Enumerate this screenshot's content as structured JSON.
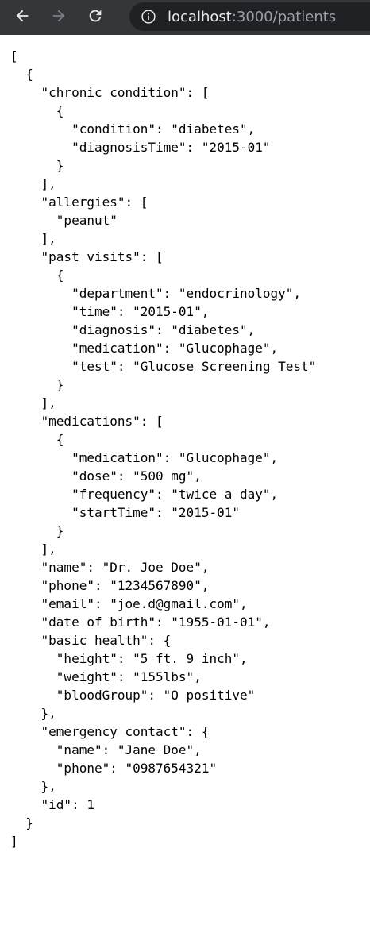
{
  "browser": {
    "back_icon": "arrow-left-icon",
    "forward_icon": "arrow-right-icon",
    "reload_icon": "reload-icon",
    "site_info_icon": "info-icon",
    "url_host": "localhost",
    "url_rest": ":3000/patients"
  },
  "json_lines": [
    "[",
    "  {",
    "    \"chronic condition\": [",
    "      {",
    "        \"condition\": \"diabetes\",",
    "        \"diagnosisTime\": \"2015-01\"",
    "      }",
    "    ],",
    "    \"allergies\": [",
    "      \"peanut\"",
    "    ],",
    "    \"past visits\": [",
    "      {",
    "        \"department\": \"endocrinology\",",
    "        \"time\": \"2015-01\",",
    "        \"diagnosis\": \"diabetes\",",
    "        \"medication\": \"Glucophage\",",
    "        \"test\": \"Glucose Screening Test\"",
    "      }",
    "    ],",
    "    \"medications\": [",
    "      {",
    "        \"medication\": \"Glucophage\",",
    "        \"dose\": \"500 mg\",",
    "        \"frequency\": \"twice a day\",",
    "        \"startTime\": \"2015-01\"",
    "      }",
    "    ],",
    "    \"name\": \"Dr. Joe Doe\",",
    "    \"phone\": \"1234567890\",",
    "    \"email\": \"joe.d@gmail.com\",",
    "    \"date of birth\": \"1955-01-01\",",
    "    \"basic health\": {",
    "      \"height\": \"5 ft. 9 inch\",",
    "      \"weight\": \"155lbs\",",
    "      \"bloodGroup\": \"O positive\"",
    "    },",
    "    \"emergency contact\": {",
    "      \"name\": \"Jane Doe\",",
    "      \"phone\": \"0987654321\"",
    "    },",
    "    \"id\": 1",
    "  }",
    "]"
  ]
}
